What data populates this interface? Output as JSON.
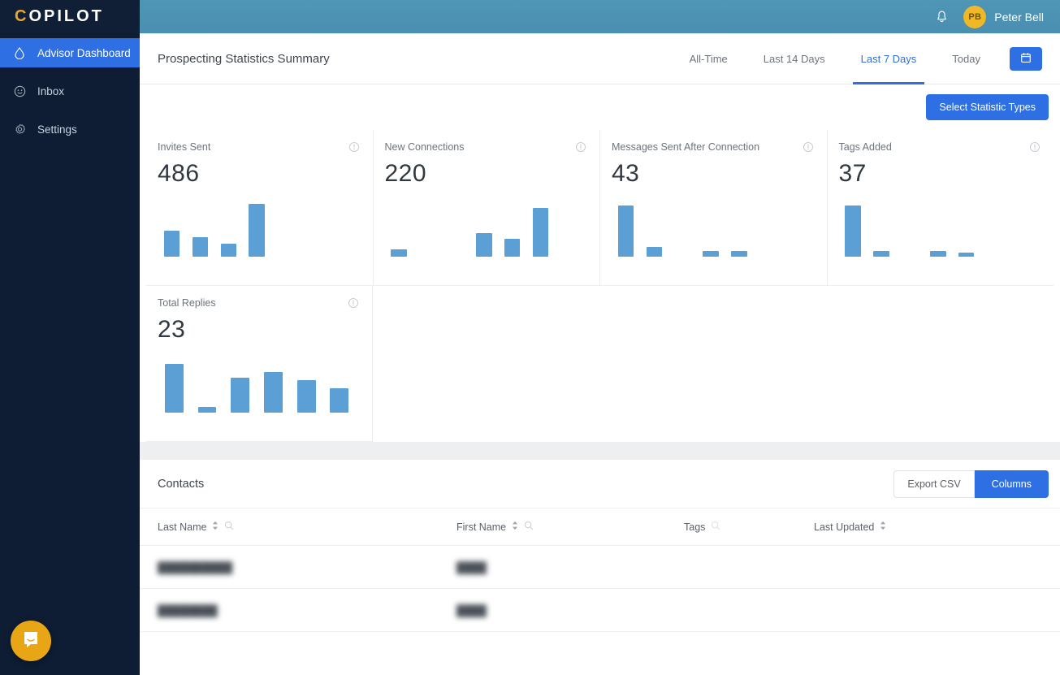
{
  "sidebar": {
    "brand_first_letter": "C",
    "brand_rest": "OPILOT",
    "items": [
      {
        "label": "Advisor Dashboard",
        "icon": "droplet-icon",
        "active": true
      },
      {
        "label": "Inbox",
        "icon": "chat-face-icon",
        "active": false
      },
      {
        "label": "Settings",
        "icon": "gear-icon",
        "active": false
      }
    ],
    "chat_launcher": "intercom-chat-icon"
  },
  "topbar": {
    "notification_icon": "bell-icon",
    "avatar_initials": "PB",
    "user_name": "Peter Bell"
  },
  "page": {
    "title": "Prospecting Statistics Summary",
    "tabs": [
      {
        "label": "All-Time",
        "active": false
      },
      {
        "label": "Last 14 Days",
        "active": false
      },
      {
        "label": "Last 7 Days",
        "active": true
      },
      {
        "label": "Today",
        "active": false
      }
    ],
    "calendar_button_icon": "calendar-icon",
    "select_stat_types_label": "Select Statistic Types"
  },
  "stats": [
    {
      "label": "Invites Sent",
      "value": "486",
      "info_icon": "info-icon"
    },
    {
      "label": "New Connections",
      "value": "220",
      "info_icon": "info-icon"
    },
    {
      "label": "Messages Sent After Connection",
      "value": "43",
      "info_icon": "info-icon"
    },
    {
      "label": "Tags Added",
      "value": "37",
      "info_icon": "info-icon"
    },
    {
      "label": "Total Replies",
      "value": "23",
      "info_icon": "info-icon"
    }
  ],
  "chart_data": [
    {
      "type": "bar",
      "title": "Invites Sent",
      "categories": [
        "1",
        "2",
        "3",
        "4",
        "5",
        "6",
        "7"
      ],
      "values": [
        22,
        17,
        11,
        45,
        0,
        0,
        0
      ],
      "xlabel": "",
      "ylabel": "",
      "ylim": [
        0,
        50
      ],
      "color": "#5b9fd4",
      "grid": false,
      "legend": "none"
    },
    {
      "type": "bar",
      "title": "New Connections",
      "categories": [
        "1",
        "2",
        "3",
        "4",
        "5",
        "6",
        "7"
      ],
      "values": [
        6,
        0,
        0,
        20,
        15,
        42,
        0
      ],
      "xlabel": "",
      "ylabel": "",
      "ylim": [
        0,
        50
      ],
      "color": "#5b9fd4",
      "grid": false,
      "legend": "none"
    },
    {
      "type": "bar",
      "title": "Messages Sent After Connection",
      "categories": [
        "1",
        "2",
        "3",
        "4",
        "5",
        "6",
        "7"
      ],
      "values": [
        44,
        8,
        0,
        5,
        5,
        0,
        0
      ],
      "xlabel": "",
      "ylabel": "",
      "ylim": [
        0,
        50
      ],
      "color": "#5b9fd4",
      "grid": false,
      "legend": "none"
    },
    {
      "type": "bar",
      "title": "Tags Added",
      "categories": [
        "1",
        "2",
        "3",
        "4",
        "5",
        "6",
        "7"
      ],
      "values": [
        44,
        5,
        0,
        5,
        3,
        0,
        0
      ],
      "xlabel": "",
      "ylabel": "",
      "ylim": [
        0,
        50
      ],
      "color": "#5b9fd4",
      "grid": false,
      "legend": "none"
    },
    {
      "type": "bar",
      "title": "Total Replies",
      "categories": [
        "1",
        "2",
        "3",
        "4",
        "5",
        "6"
      ],
      "values": [
        42,
        5,
        30,
        35,
        28,
        21
      ],
      "xlabel": "",
      "ylabel": "",
      "ylim": [
        0,
        50
      ],
      "color": "#5b9fd4",
      "grid": false,
      "legend": "none"
    }
  ],
  "contacts": {
    "title": "Contacts",
    "export_label": "Export CSV",
    "columns_label": "Columns",
    "headers": [
      {
        "label": "Last Name",
        "sortable": true,
        "searchable": true
      },
      {
        "label": "First Name",
        "sortable": true,
        "searchable": true
      },
      {
        "label": "Tags",
        "sortable": false,
        "searchable": true
      },
      {
        "label": "Last Updated",
        "sortable": true,
        "searchable": false
      }
    ],
    "rows": [
      {
        "last_name": "██████████",
        "first_name": "████",
        "tags": "",
        "last_updated": ""
      },
      {
        "last_name": "████████",
        "first_name": "████",
        "tags": "",
        "last_updated": ""
      }
    ]
  },
  "colors": {
    "sidebar_bg": "#0e1d33",
    "accent_blue": "#2f6fe4",
    "topbar_blue": "#4f95b4",
    "bar_blue": "#5b9fd4",
    "avatar_yellow": "#f0b827",
    "chat_yellow": "#e8a617"
  }
}
